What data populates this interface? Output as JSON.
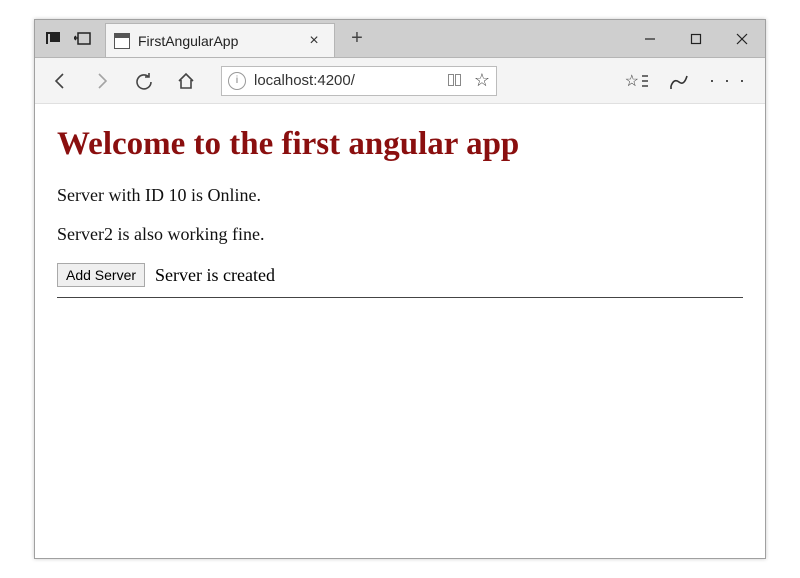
{
  "browser": {
    "tab_title": "FirstAngularApp",
    "url": "localhost:4200/"
  },
  "content": {
    "heading": "Welcome to the first angular app",
    "server_status_1": "Server with ID 10 is Online.",
    "server_status_2": "Server2 is also working fine.",
    "add_server_button": "Add Server",
    "server_created_text": "Server is created"
  }
}
